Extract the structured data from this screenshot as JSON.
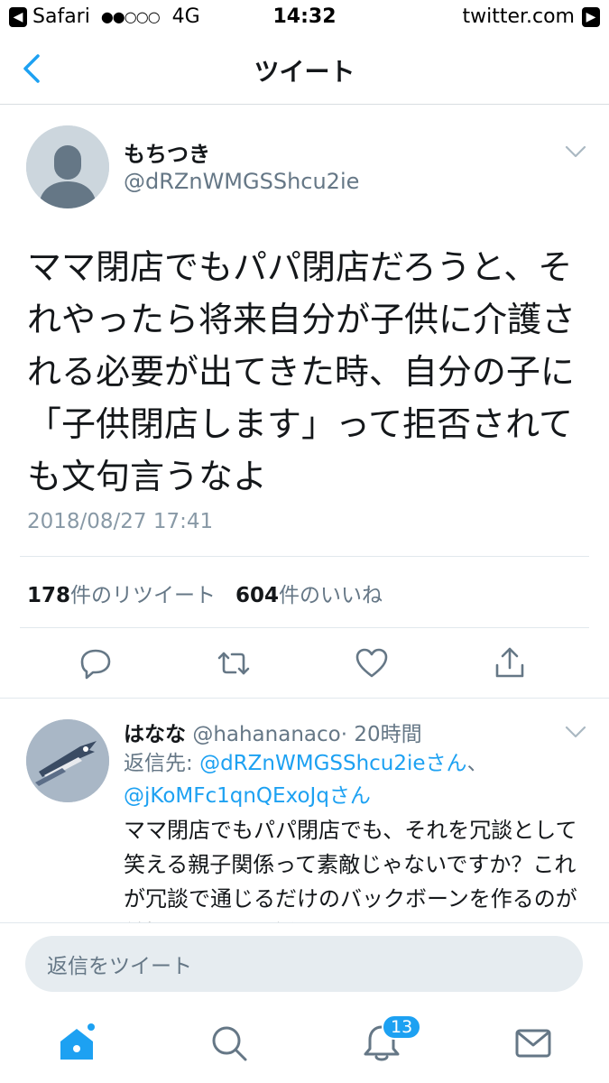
{
  "status_bar": {
    "carrier": "Safari",
    "signal": "●●○○○",
    "network": "4G",
    "time": "14:32",
    "url": "twitter.com"
  },
  "nav": {
    "title": "ツイート"
  },
  "tweet": {
    "author_name": "もちつき",
    "author_handle": "@dRZnWMGSShcu2ie",
    "text": "ママ閉店でもパパ閉店だろうと、それやったら将来自分が子供に介護される必要が出てきた時、自分の子に「子供閉店します」って拒否されても文句言うなよ",
    "timestamp": "2018/08/27 17:41",
    "retweet_count": "178",
    "retweet_label": "件のリツイート",
    "like_count": "604",
    "like_label": "件のいいね"
  },
  "reply": {
    "name": "はなな",
    "handle": "@hahananaco",
    "time": "· 20時間",
    "reply_to_label": "返信先: ",
    "reply_to_user1": "@dRZnWMGSShcu2ieさん",
    "reply_to_sep": "、",
    "reply_to_user2": "@jKoMFc1qnQExoJqさん",
    "text": "ママ閉店でもパパ閉店でも、それを冗談として笑える親子関係って素敵じゃないですか？これが冗談で通じるだけのバックボーンを作るのが前提としてある話なんだ"
  },
  "compose": {
    "placeholder": "返信をツイート"
  },
  "tabbar": {
    "notifications_badge": "13"
  },
  "colors": {
    "accent": "#1da1f2",
    "muted": "#657786",
    "icon": "#657786"
  },
  "icons": [
    "back-icon",
    "chevron-down-icon",
    "reply-icon",
    "retweet-icon",
    "like-icon",
    "share-icon",
    "home-icon",
    "search-icon",
    "notifications-icon",
    "messages-icon"
  ]
}
